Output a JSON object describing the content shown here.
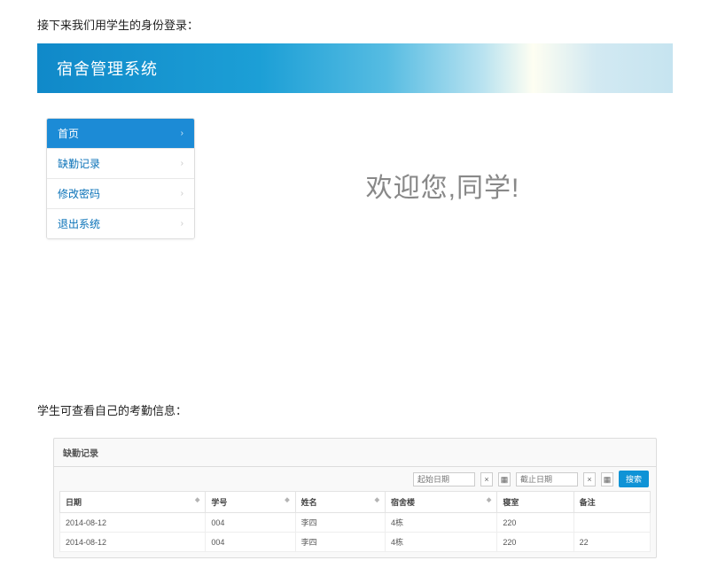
{
  "intro1": "接下来我们用学生的身份登录：",
  "header": {
    "title": "宿舍管理系统"
  },
  "sidebar": {
    "items": [
      {
        "label": "首页",
        "active": true
      },
      {
        "label": "缺勤记录",
        "active": false
      },
      {
        "label": "修改密码",
        "active": false
      },
      {
        "label": "退出系统",
        "active": false
      }
    ]
  },
  "main": {
    "welcome": "欢迎您,同学!"
  },
  "intro2": "学生可查看自己的考勤信息：",
  "panel": {
    "title": "缺勤记录",
    "filters": {
      "start_placeholder": "起始日期",
      "end_placeholder": "截止日期",
      "clear": "×",
      "cal": "▦",
      "search": "搜索"
    },
    "columns": [
      {
        "label": "日期",
        "sortable": true
      },
      {
        "label": "学号",
        "sortable": true
      },
      {
        "label": "姓名",
        "sortable": true
      },
      {
        "label": "宿舍楼",
        "sortable": true
      },
      {
        "label": "寝室",
        "sortable": false
      },
      {
        "label": "备注",
        "sortable": false
      }
    ],
    "rows": [
      {
        "date": "2014-08-12",
        "sid": "004",
        "name": "李四",
        "building": "4栋",
        "room": "220",
        "remark": ""
      },
      {
        "date": "2014-08-12",
        "sid": "004",
        "name": "李四",
        "building": "4栋",
        "room": "220",
        "remark": "22"
      }
    ]
  }
}
